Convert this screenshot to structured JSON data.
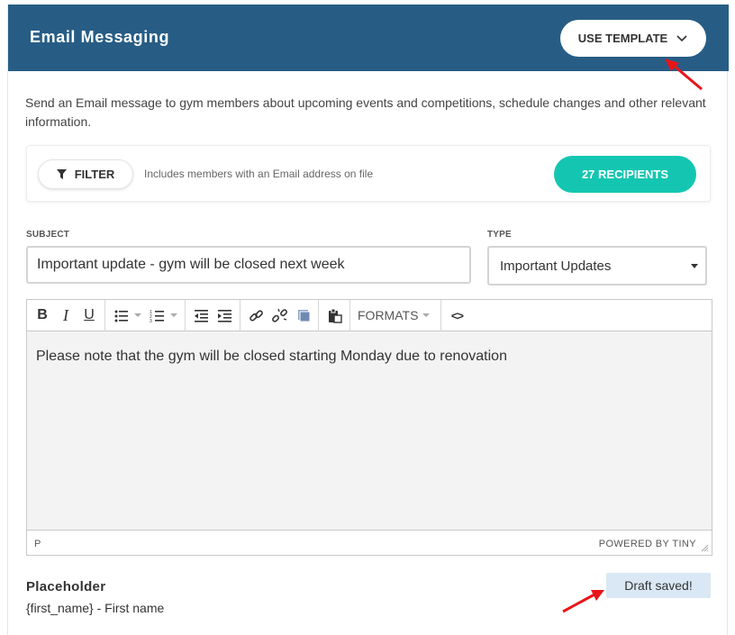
{
  "header": {
    "title": "Email Messaging",
    "template_button": "USE TEMPLATE",
    "background": "#275d85"
  },
  "description": "Send an Email message to gym members about upcoming events and competitions, schedule changes and other relevant information.",
  "filter": {
    "button_label": "FILTER",
    "note": "Includes members with an Email address on file",
    "recipients_label": "27 RECIPIENTS",
    "recipients_color": "#14c6b1"
  },
  "subject": {
    "label": "SUBJECT",
    "value": "Important update - gym will be closed next week"
  },
  "type": {
    "label": "TYPE",
    "selected": "Important Updates"
  },
  "editor": {
    "toolbar": {
      "bold": "B",
      "italic": "I",
      "underline": "U",
      "formats": "FORMATS",
      "source": "<>"
    },
    "body": "Please note that the gym will be closed starting Monday due to renovation",
    "path": "P",
    "branding": "POWERED BY TINY"
  },
  "placeholder": {
    "title": "Placeholder",
    "item": "{first_name} - First name"
  },
  "draft_status": "Draft saved!",
  "annotation_color": "#e8151b"
}
